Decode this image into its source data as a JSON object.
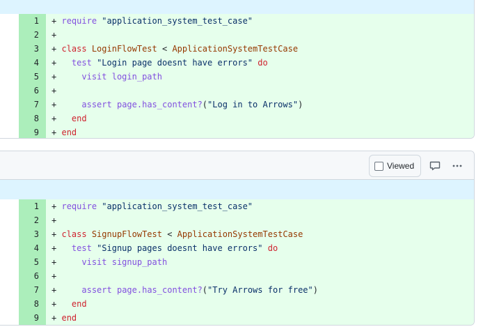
{
  "files": [
    {
      "header_visible": false,
      "lines": [
        {
          "num": "1",
          "sign": "+",
          "code": "require \"application_system_test_case\""
        },
        {
          "num": "2",
          "sign": "+",
          "code": ""
        },
        {
          "num": "3",
          "sign": "+",
          "code": "class LoginFlowTest < ApplicationSystemTestCase"
        },
        {
          "num": "4",
          "sign": "+",
          "code": "  test \"Login page doesnt have errors\" do"
        },
        {
          "num": "5",
          "sign": "+",
          "code": "    visit login_path"
        },
        {
          "num": "6",
          "sign": "+",
          "code": ""
        },
        {
          "num": "7",
          "sign": "+",
          "code": "    assert page.has_content?(\"Log in to Arrows\")"
        },
        {
          "num": "8",
          "sign": "+",
          "code": "  end"
        },
        {
          "num": "9",
          "sign": "+",
          "code": "end"
        }
      ]
    },
    {
      "header_visible": true,
      "viewed_label": "Viewed",
      "lines": [
        {
          "num": "1",
          "sign": "+",
          "code": "require \"application_system_test_case\""
        },
        {
          "num": "2",
          "sign": "+",
          "code": ""
        },
        {
          "num": "3",
          "sign": "+",
          "code": "class SignupFlowTest < ApplicationSystemTestCase"
        },
        {
          "num": "4",
          "sign": "+",
          "code": "  test \"Signup pages doesnt have errors\" do"
        },
        {
          "num": "5",
          "sign": "+",
          "code": "    visit signup_path"
        },
        {
          "num": "6",
          "sign": "+",
          "code": ""
        },
        {
          "num": "7",
          "sign": "+",
          "code": "    assert page.has_content?(\"Try Arrows for free\")"
        },
        {
          "num": "8",
          "sign": "+",
          "code": "  end"
        },
        {
          "num": "9",
          "sign": "+",
          "code": "end"
        }
      ]
    }
  ],
  "icons": {
    "comment": "comment-icon",
    "more": "kebab-horizontal-icon"
  },
  "colors": {
    "addition_bg": "#e6ffec",
    "addition_num_bg": "#aceebb",
    "hunk_bg": "#ddf4ff",
    "keyword": "#cf222e",
    "string": "#0a3069",
    "class_name": "#953800",
    "method": "#8250df"
  }
}
